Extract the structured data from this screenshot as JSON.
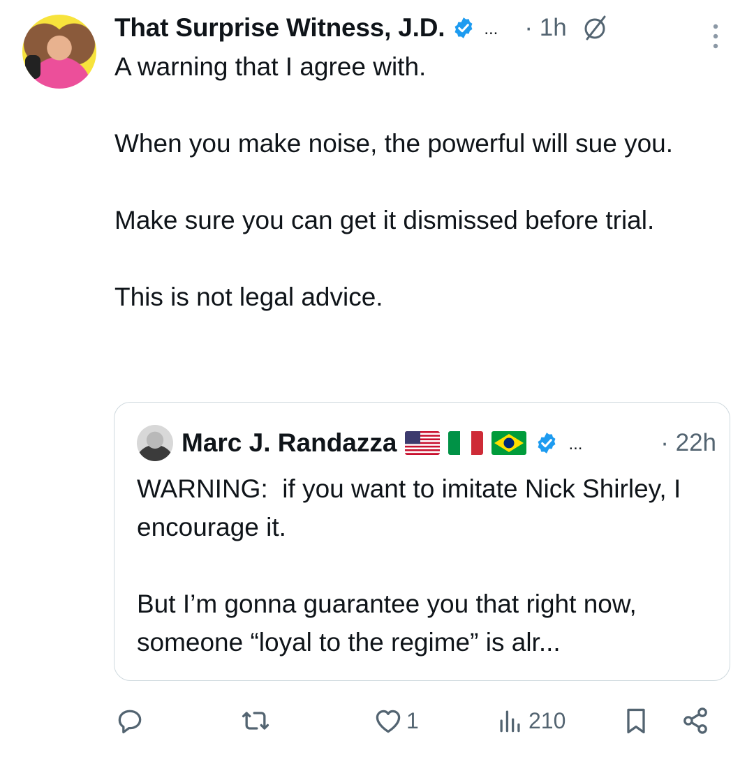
{
  "author": {
    "display_name": "That Surprise Witness, J.D.",
    "ellipsis": "...",
    "time": "· 1h"
  },
  "tweet": {
    "text": "A warning that I agree with.\n\nWhen you make noise, the powerful will sue you.\n\nMake sure you can get it dismissed before trial.\n\nThis is not legal advice."
  },
  "quote": {
    "display_name": "Marc J. Randazza",
    "flags": [
      "us-flag",
      "italy-flag",
      "brazil-flag"
    ],
    "ellipsis": "...",
    "time": "· 22h",
    "text": "WARNING:  if you want to imitate Nick Shirley, I encourage it.\n\nBut I’m gonna guarantee you that right now, someone “loyal to the regime” is alr..."
  },
  "actions": {
    "reply_count": "",
    "repost_count": "",
    "like_count": "1",
    "views_count": "210"
  },
  "colors": {
    "verified": "#1d9bf0",
    "secondary_text": "#536471",
    "border": "#cfd9de"
  }
}
